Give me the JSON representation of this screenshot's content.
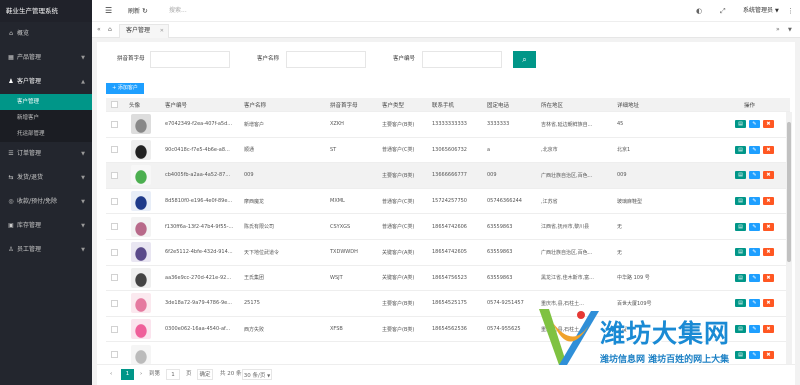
{
  "app": {
    "title": "鞋业生产管理系统"
  },
  "sidebar": {
    "items": [
      {
        "label": "概览",
        "icon": "home-icon",
        "has_arrow": false
      },
      {
        "label": "产品管理",
        "icon": "grid-icon",
        "has_arrow": true
      },
      {
        "label": "客户管理",
        "icon": "user-icon",
        "has_arrow": true,
        "open": true
      },
      {
        "label": "订单管理",
        "icon": "list-icon",
        "has_arrow": true
      },
      {
        "label": "发货/退货",
        "icon": "truck-icon",
        "has_arrow": true
      },
      {
        "label": "收款/预付/免除",
        "icon": "money-icon",
        "has_arrow": true
      },
      {
        "label": "库存管理",
        "icon": "box-icon",
        "has_arrow": true
      },
      {
        "label": "员工管理",
        "icon": "staff-icon",
        "has_arrow": true
      }
    ],
    "sub_items": [
      {
        "label": "客户管理",
        "active": true
      },
      {
        "label": "新增客户",
        "active": false
      },
      {
        "label": "托运部管理",
        "active": false
      }
    ]
  },
  "header": {
    "menu_icon": "menu-icon",
    "refresh_label": "刷新",
    "search_placeholder": "搜索...",
    "user_label": "系统管理员"
  },
  "tabs": {
    "active_label": "客户管理"
  },
  "filters": {
    "pinyin_label": "拼音首字母",
    "name_label": "客户名称",
    "code_label": "客户编号",
    "pinyin_value": "",
    "name_value": "",
    "code_value": ""
  },
  "add_button_label": "添加客户",
  "table": {
    "columns": [
      "头像",
      "客户编号",
      "客户名称",
      "拼音首字母",
      "客户类型",
      "联系手机",
      "固定电话",
      "所在地区",
      "详细地址",
      "操作"
    ],
    "rows": [
      {
        "code": "e7042349-f2ea-407f-a5d...",
        "name": "新增客户",
        "pinyin": "XZKH",
        "type": "主要客户(B类)",
        "mobile": "13333333333",
        "phone": "3333333",
        "region": "吉林省,延边朝鲜族自...",
        "address": "45",
        "avatar": "shoe-gray"
      },
      {
        "code": "90c0418c-f7e5-4b6e-a8...",
        "name": "顺通",
        "pinyin": "ST",
        "type": "普通客户(C类)",
        "mobile": "13065606732",
        "phone": "a",
        "region": ",北京市",
        "address": "北京1",
        "avatar": "shoe-black"
      },
      {
        "code": "cb4005fb-a2aa-4a52-87...",
        "name": "009",
        "pinyin": "",
        "type": "主要客户(B类)",
        "mobile": "13666666777",
        "phone": "009",
        "region": "广西壮族自治区,百色...",
        "address": "009",
        "avatar": "flask-green",
        "highlight": true
      },
      {
        "code": "8d5810f0-e196-4e0f-89e...",
        "name": "摩西魔龙",
        "pinyin": "MXML",
        "type": "普通客户(C类)",
        "mobile": "15724257750",
        "phone": "05746366244",
        "region": ",江苏省",
        "address": "玻璃麻鞋型",
        "avatar": "shoe-blue"
      },
      {
        "code": "f130ff6a-13f2-47b4-9f55-...",
        "name": "陈氏有限公司",
        "pinyin": "CSYXGS",
        "type": "普通客户(C类)",
        "mobile": "18654742606",
        "phone": "63559863",
        "region": "江西省,抚州市,黎川县",
        "address": "无",
        "avatar": "shoe-pink"
      },
      {
        "code": "6f2e5112-4bfe-432d-914...",
        "name": "天下地位武道令",
        "pinyin": "TXDWWDH",
        "type": "关键客户(A类)",
        "mobile": "18654742605",
        "phone": "63559863",
        "region": "广西壮族自治区,百色...",
        "address": "无",
        "avatar": "shoe-purple"
      },
      {
        "code": "aa36e9cc-270d-421e-92...",
        "name": "王氏集团",
        "pinyin": "WSJT",
        "type": "关键客户(A类)",
        "mobile": "18654756523",
        "phone": "63559863",
        "region": "黑龙江省,佳木斯市,富...",
        "address": "中华路 109 号",
        "avatar": "shoe-stripe"
      },
      {
        "code": "3de18a72-9a79-4786-9e...",
        "name": "25175",
        "pinyin": "",
        "type": "主要客户(B类)",
        "mobile": "18654525175",
        "phone": "0574-9251457",
        "region": "重庆市,县,石柱土...",
        "address": "百世大厦109号",
        "avatar": "shoe-pink2"
      },
      {
        "code": "0300e062-16aa-4540-af...",
        "name": "西方失败",
        "pinyin": "XFSB",
        "type": "主要客户(B类)",
        "mobile": "18654562536",
        "phone": "0574-955625",
        "region": "重庆市,县,石柱土...",
        "address": "大厦",
        "avatar": "shoe-pink3"
      },
      {
        "code": "",
        "name": "",
        "pinyin": "",
        "type": "",
        "mobile": "",
        "phone": "",
        "region": "",
        "address": "",
        "avatar": "shoe-white"
      }
    ]
  },
  "pager": {
    "current": "1",
    "goto_label": "到第",
    "goto_value": "1",
    "page_unit": "页",
    "confirm_label": "确定",
    "total_label": "共 20 条",
    "size_label": "30 条/页"
  },
  "watermark": {
    "title": "潍坊大集网",
    "subtitle": "潍坊信息网 潍坊百姓的网上大集"
  }
}
